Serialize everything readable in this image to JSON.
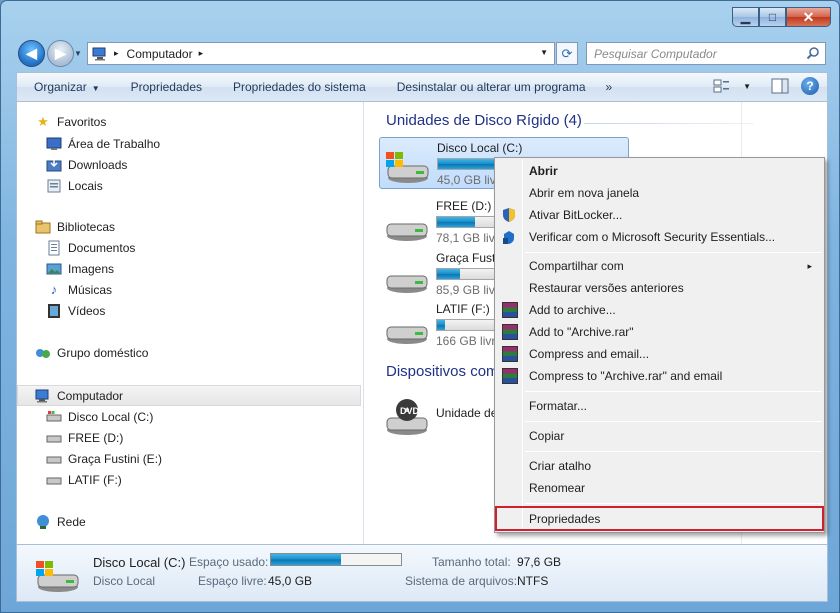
{
  "window": {
    "caption": {
      "minimize": "▁",
      "maximize": "□",
      "close": "✕"
    }
  },
  "navigation": {
    "back_icon": "back-arrow-icon",
    "forward_icon": "forward-arrow-icon",
    "address": {
      "crumb": "Computador",
      "separator": "▸"
    },
    "search_placeholder": "Pesquisar Computador"
  },
  "toolbar": {
    "organize": "Organizar",
    "properties": "Propriedades",
    "system_properties": "Propriedades do sistema",
    "uninstall": "Desinstalar ou alterar um programa",
    "more": "»"
  },
  "sidebar": {
    "favorites": {
      "label": "Favoritos",
      "items": [
        "Área de Trabalho",
        "Downloads",
        "Locais"
      ]
    },
    "libraries": {
      "label": "Bibliotecas",
      "items": [
        "Documentos",
        "Imagens",
        "Músicas",
        "Vídeos"
      ]
    },
    "homegroup": "Grupo doméstico",
    "computer": {
      "label": "Computador",
      "items": [
        "Disco Local (C:)",
        "FREE (D:)",
        "Graça Fustini (E:)",
        "LATIF (F:)"
      ]
    },
    "network": "Rede"
  },
  "main": {
    "hdd_group": "Unidades de Disco Rígido (4)",
    "removable_group": "Dispositivos com",
    "drives": [
      {
        "name": "Disco Local (C:)",
        "free": "45,0 GB livr",
        "used_fraction": 0.54
      },
      {
        "name": "FREE (D:)",
        "free": "78,1 GB livr",
        "used_fraction": 0.2
      },
      {
        "name": "Graça Fustini",
        "free": "85,9 GB livr",
        "used_fraction": 0.12
      },
      {
        "name": "LATIF (F:)",
        "free": "166 GB livr",
        "used_fraction": 0.04
      }
    ],
    "dvd": {
      "name": "Unidade de",
      "badge": "DVD"
    }
  },
  "context_menu": {
    "items": [
      "Abrir",
      "Abrir em nova janela",
      "Ativar BitLocker...",
      "Verificar com o Microsoft Security Essentials...",
      "Compartilhar com",
      "Restaurar versões anteriores",
      "Add to archive...",
      "Add to \"Archive.rar\"",
      "Compress and email...",
      "Compress to \"Archive.rar\" and email",
      "Formatar...",
      "Copiar",
      "Criar atalho",
      "Renomear",
      "Propriedades"
    ],
    "submenu_arrow": "▸"
  },
  "details": {
    "name": "Disco Local (C:)",
    "type": "Disco Local",
    "used_label": "Espaço usado:",
    "free_label": "Espaço livre:",
    "free_value": "45,0 GB",
    "total_label": "Tamanho total:",
    "total_value": "97,6 GB",
    "fs_label": "Sistema de arquivos:",
    "fs_value": "NTFS",
    "used_fraction": 0.54
  }
}
